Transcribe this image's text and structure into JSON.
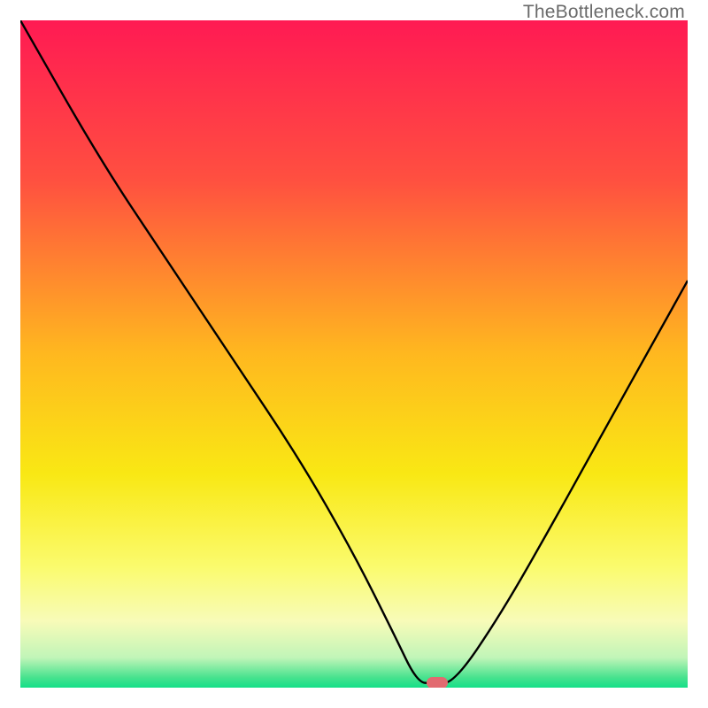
{
  "watermark": "TheBottleneck.com",
  "chart_data": {
    "type": "line",
    "title": "",
    "xlabel": "",
    "ylabel": "",
    "xlim": [
      0,
      100
    ],
    "ylim": [
      0,
      100
    ],
    "grid": false,
    "series": [
      {
        "name": "bottleneck-curve",
        "x": [
          0,
          12,
          22,
          32,
          42,
          50,
          56,
          59.5,
          62,
          65,
          72,
          80,
          88,
          95,
          100
        ],
        "y": [
          100,
          79,
          64,
          49,
          34,
          20,
          8,
          0.7,
          0.7,
          0.7,
          11,
          25,
          39.5,
          52,
          61
        ]
      }
    ],
    "marker": {
      "name": "optimal-point",
      "x": 62.5,
      "y": 0.7,
      "color": "#e26a70"
    },
    "gradient_stops": [
      {
        "offset": 0,
        "color": "#ff1a53"
      },
      {
        "offset": 0.24,
        "color": "#ff5040"
      },
      {
        "offset": 0.5,
        "color": "#ffb81f"
      },
      {
        "offset": 0.68,
        "color": "#f9e814"
      },
      {
        "offset": 0.82,
        "color": "#fafb6e"
      },
      {
        "offset": 0.9,
        "color": "#f8fbb8"
      },
      {
        "offset": 0.955,
        "color": "#c1f5b8"
      },
      {
        "offset": 0.985,
        "color": "#47e28e"
      },
      {
        "offset": 1.0,
        "color": "#14df88"
      }
    ]
  }
}
